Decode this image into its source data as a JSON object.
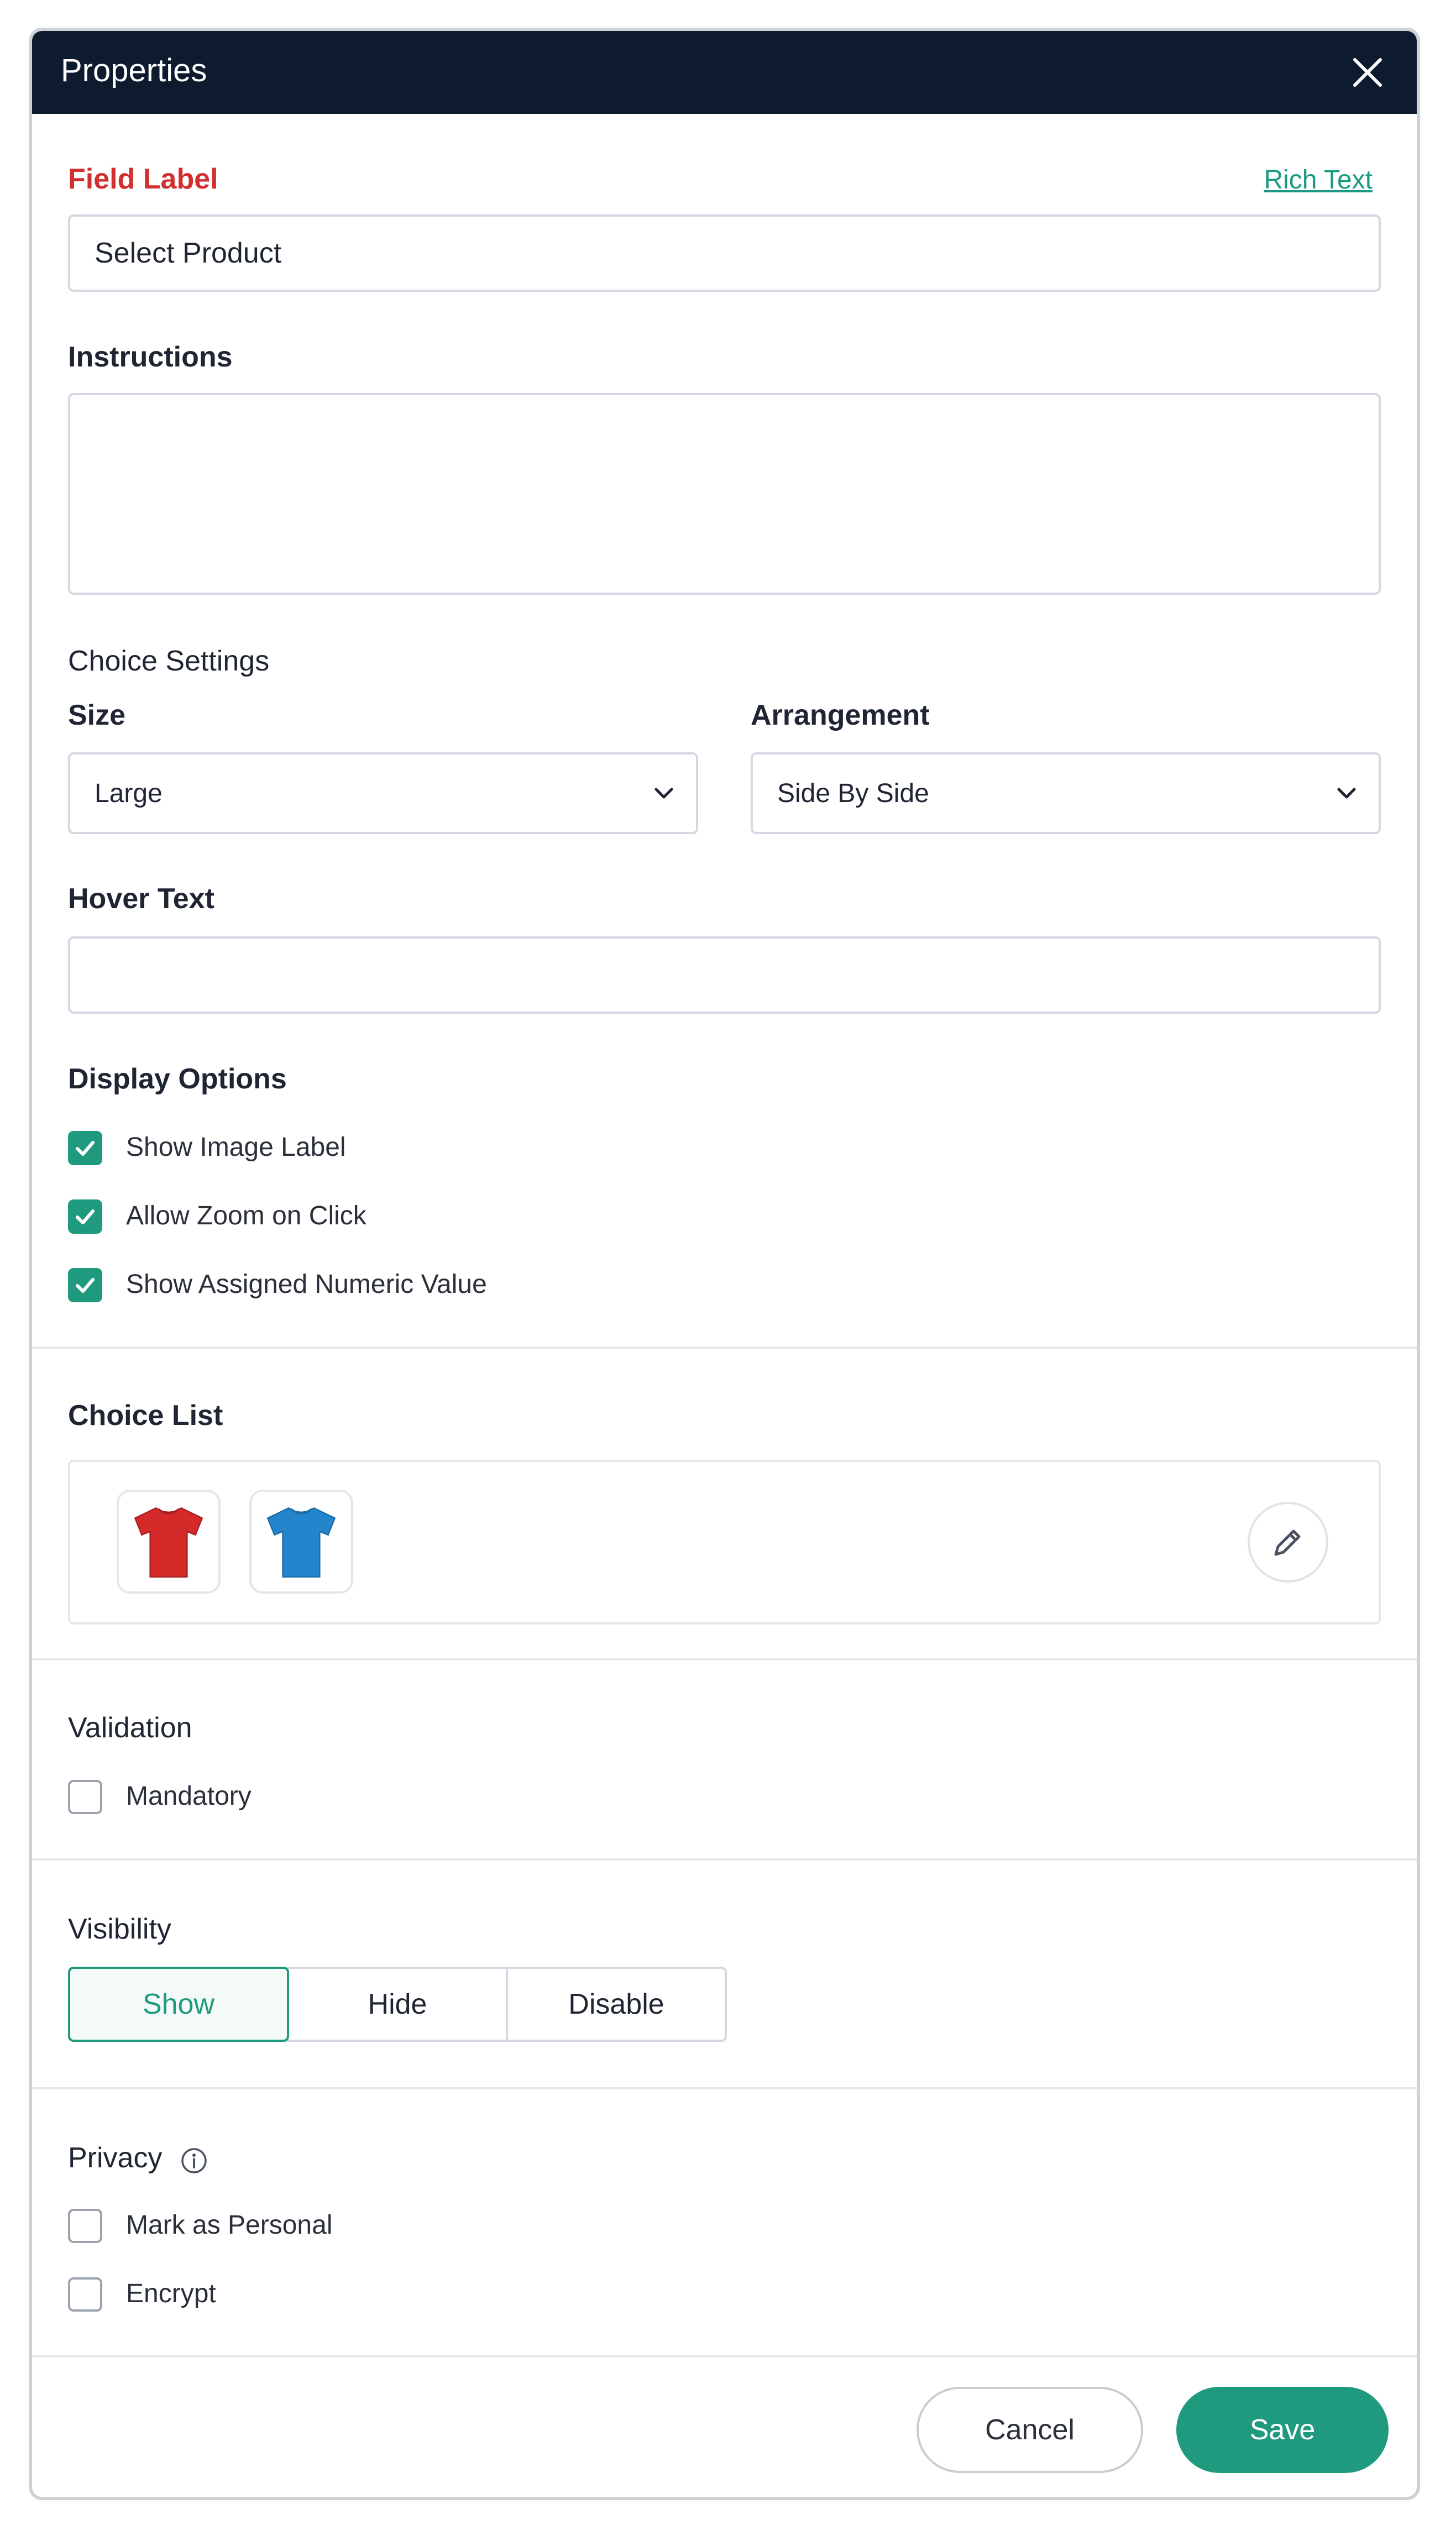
{
  "header": {
    "title": "Properties"
  },
  "field_label": {
    "label": "Field Label",
    "rich_text_link": "Rich Text",
    "value": "Select Product"
  },
  "instructions": {
    "label": "Instructions",
    "value": ""
  },
  "choice_settings": {
    "heading": "Choice Settings",
    "size": {
      "label": "Size",
      "value": "Large"
    },
    "arrangement": {
      "label": "Arrangement",
      "value": "Side By Side"
    }
  },
  "hover_text": {
    "label": "Hover Text",
    "value": ""
  },
  "display_options": {
    "heading": "Display Options",
    "items": [
      {
        "label": "Show Image Label",
        "checked": true
      },
      {
        "label": "Allow Zoom on Click",
        "checked": true
      },
      {
        "label": "Show Assigned Numeric Value",
        "checked": true
      }
    ]
  },
  "choice_list": {
    "heading": "Choice List",
    "items": [
      {
        "icon": "red-tshirt-image",
        "color": "#d42a2a"
      },
      {
        "icon": "blue-tshirt-image",
        "color": "#2386cc"
      }
    ]
  },
  "validation": {
    "heading": "Validation",
    "mandatory": {
      "label": "Mandatory",
      "checked": false
    }
  },
  "visibility": {
    "heading": "Visibility",
    "options": [
      "Show",
      "Hide",
      "Disable"
    ],
    "selected": "Show"
  },
  "privacy": {
    "heading": "Privacy",
    "items": [
      {
        "label": "Mark as Personal",
        "checked": false
      },
      {
        "label": "Encrypt",
        "checked": false
      }
    ]
  },
  "footer": {
    "cancel_label": "Cancel",
    "save_label": "Save"
  },
  "colors": {
    "accent": "#1f9a7e",
    "header_bg": "#0e1a2e",
    "required_label": "#d32f2f"
  }
}
